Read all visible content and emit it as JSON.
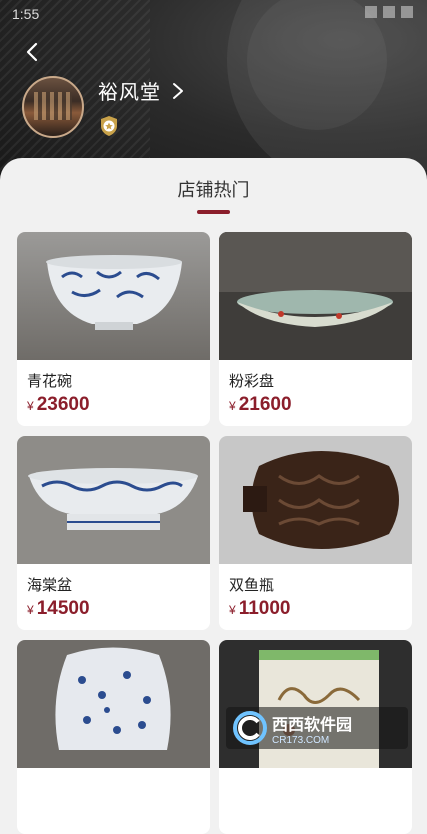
{
  "status": {
    "time": "1:55"
  },
  "shop": {
    "name": "裕风堂"
  },
  "section": {
    "title": "店铺热门"
  },
  "currency": "¥",
  "products": [
    {
      "name": "青花碗",
      "price": "23600"
    },
    {
      "name": "粉彩盘",
      "price": "21600"
    },
    {
      "name": "海棠盆",
      "price": "14500"
    },
    {
      "name": "双鱼瓶",
      "price": "11000"
    },
    {
      "name": "",
      "price": ""
    },
    {
      "name": "",
      "price": ""
    }
  ],
  "watermark": {
    "title": "西西软件园",
    "sub": "CR173.COM"
  },
  "colors": {
    "accent": "#8b1e2b",
    "header_dark": "#1e1e1e"
  }
}
